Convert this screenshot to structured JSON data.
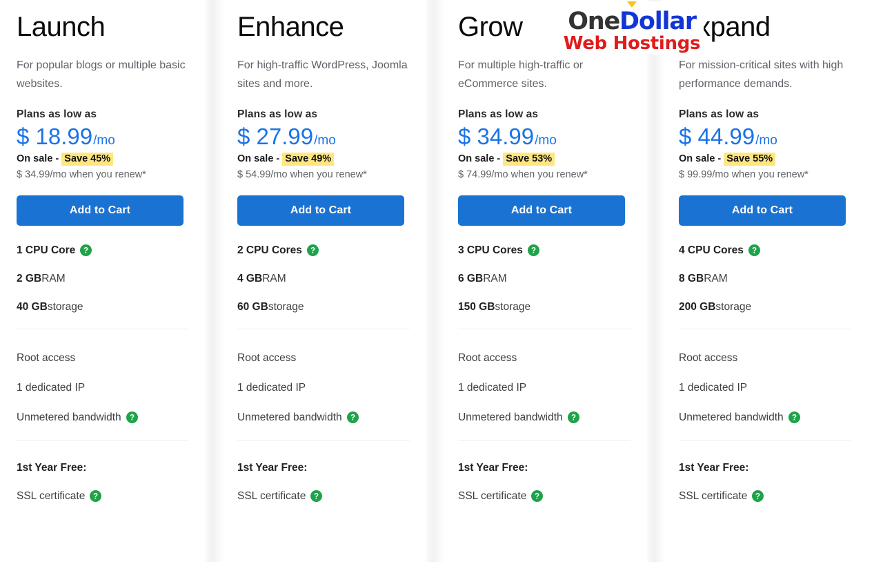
{
  "logo": {
    "caret_color": "#f5c518",
    "part_one": "One",
    "part_two": "Dollar",
    "tagline": "Web Hostings",
    "color_one": "#333333",
    "color_two": "#1236d6",
    "color_tagline": "#e01b1b"
  },
  "common": {
    "plans_low_label": "Plans as low as",
    "on_sale_prefix": "On sale - ",
    "cart_label": "Add to Cart",
    "free_head": "1st Year Free:",
    "help_icon": "help-question-icon",
    "accent_blue": "#1a73e8",
    "button_blue": "#1a73d2",
    "highlight_yellow": "#ffe680",
    "help_green": "#1fa34a"
  },
  "plans": [
    {
      "title": "Launch",
      "desc": "For popular blogs or multiple basic websites.",
      "price_amount": "$ 18.99",
      "price_per": "/mo",
      "save_label": "Save 45%",
      "renew": "$ 34.99/mo when you renew*",
      "cpu_bold": "1 CPU Core",
      "cpu_has_help": true,
      "ram_bold": "2 GB",
      "ram_rest": " RAM",
      "storage_bold": "40 GB",
      "storage_rest": " storage",
      "features": [
        {
          "label": "Root access",
          "help": false
        },
        {
          "label": "1 dedicated IP",
          "help": false
        },
        {
          "label": "Unmetered bandwidth",
          "help": true
        }
      ],
      "free_items": [
        {
          "label": "SSL certificate",
          "help": true
        }
      ]
    },
    {
      "title": "Enhance",
      "desc": "For high-traffic WordPress, Joomla sites and more.",
      "price_amount": "$ 27.99",
      "price_per": "/mo",
      "save_label": "Save 49%",
      "renew": "$ 54.99/mo when you renew*",
      "cpu_bold": "2 CPU Cores",
      "cpu_has_help": true,
      "ram_bold": "4 GB",
      "ram_rest": " RAM",
      "storage_bold": "60 GB",
      "storage_rest": " storage",
      "features": [
        {
          "label": "Root access",
          "help": false
        },
        {
          "label": "1 dedicated IP",
          "help": false
        },
        {
          "label": "Unmetered bandwidth",
          "help": true
        }
      ],
      "free_items": [
        {
          "label": "SSL certificate",
          "help": true
        }
      ]
    },
    {
      "title": "Grow",
      "desc": "For multiple high-traffic or eCommerce sites.",
      "price_amount": "$ 34.99",
      "price_per": "/mo",
      "save_label": "Save 53%",
      "renew": "$ 74.99/mo when you renew*",
      "cpu_bold": "3 CPU Cores",
      "cpu_has_help": true,
      "ram_bold": "6 GB",
      "ram_rest": " RAM",
      "storage_bold": "150 GB",
      "storage_rest": " storage",
      "features": [
        {
          "label": "Root access",
          "help": false
        },
        {
          "label": "1 dedicated IP",
          "help": false
        },
        {
          "label": "Unmetered bandwidth",
          "help": true
        }
      ],
      "free_items": [
        {
          "label": "SSL certificate",
          "help": true
        }
      ]
    },
    {
      "title": "Expand",
      "desc": "For mission-critical sites with high performance demands.",
      "price_amount": "$ 44.99",
      "price_per": "/mo",
      "save_label": "Save 55%",
      "renew": "$ 99.99/mo when you renew*",
      "cpu_bold": "4 CPU Cores",
      "cpu_has_help": true,
      "ram_bold": "8 GB",
      "ram_rest": " RAM",
      "storage_bold": "200 GB",
      "storage_rest": " storage",
      "features": [
        {
          "label": "Root access",
          "help": false
        },
        {
          "label": "1 dedicated IP",
          "help": false
        },
        {
          "label": "Unmetered bandwidth",
          "help": true
        }
      ],
      "free_items": [
        {
          "label": "SSL certificate",
          "help": true
        }
      ]
    }
  ]
}
